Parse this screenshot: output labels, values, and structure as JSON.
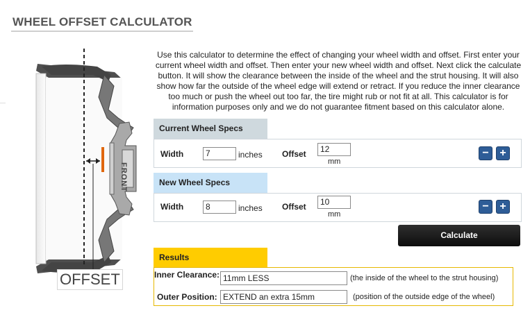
{
  "page": {
    "title": "WHEEL OFFSET CALCULATOR"
  },
  "diagram": {
    "front_label": "FRONT",
    "offset_label": "OFFSET"
  },
  "description": "Use this calculator to determine the effect of changing your wheel width and offset. First enter your current wheel width and offset. Then enter your new wheel width and offset. Next click the calculate button. It will show the clearance between the inside of the wheel and the strut housing. It will also show how far the outside of the wheel edge will extend or retract. If you reduce the inner clearance too much or push the wheel out too far, the tire might rub or not fit at all. This calculator is for information purposes only and we do not guarantee fitment based on this calculator alone.",
  "current": {
    "heading": "Current Wheel Specs",
    "width_label": "Width",
    "width_value": "7",
    "width_unit": "inches",
    "offset_label": "Offset",
    "offset_value": "12",
    "offset_unit": "mm"
  },
  "new": {
    "heading": "New Wheel Specs",
    "width_label": "Width",
    "width_value": "8",
    "width_unit": "inches",
    "offset_label": "Offset",
    "offset_value": "10",
    "offset_unit": "mm"
  },
  "buttons": {
    "minus": "−",
    "plus": "+",
    "calculate": "Calculate"
  },
  "results": {
    "heading": "Results",
    "inner_label": "Inner Clearance:",
    "inner_value": "11mm LESS",
    "inner_note": "(the inside of the wheel to the strut housing)",
    "outer_label": "Outer Position:",
    "outer_value": "EXTEND an extra 15mm",
    "outer_note": "(position of the outside edge of the wheel)"
  },
  "colors": {
    "current_header": "#cfd9de",
    "new_header": "#c8e3f7",
    "results_header": "#ffcc00",
    "stepper": "#2e5d97",
    "offset_marker": "#e0670e"
  }
}
